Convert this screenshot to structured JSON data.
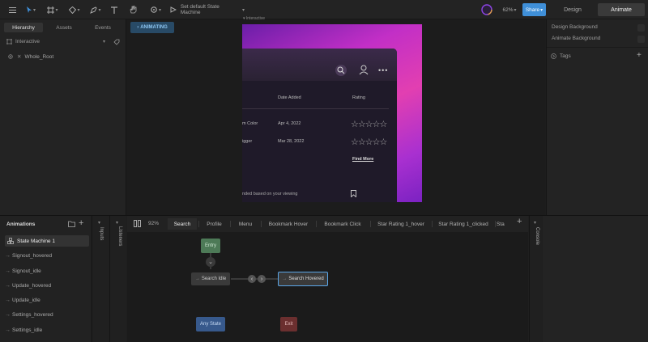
{
  "toolbar": {
    "state_machine_label": "Set default State Machine",
    "zoom": "62%",
    "share": "Share",
    "modes": [
      "Design",
      "Animate"
    ],
    "active_mode": "Animate"
  },
  "left": {
    "tabs": [
      "Hierarchy",
      "Assets",
      "Events"
    ],
    "active_tab": "Hierarchy",
    "artboard": "Interactive",
    "root": "Whole_Root"
  },
  "canvas": {
    "animating_badge": "ANIMATING",
    "artboard_label": "Interactive",
    "table": {
      "col_added": "Date Added",
      "col_rating": "Rating",
      "rows": [
        {
          "name": "m Color",
          "date": "Apr 4, 2022"
        },
        {
          "name": "igger",
          "date": "Mar 28, 2022"
        }
      ],
      "find_more": "Find More",
      "footer": "nded based on your viewing"
    }
  },
  "right": {
    "design_bg": "Design Background",
    "animate_bg": "Animate Background",
    "tags": "Tags"
  },
  "bottom": {
    "animations_title": "Animations",
    "animations": [
      "State Machine 1",
      "Signout_hovered",
      "Signout_idle",
      "Update_hovered",
      "Update_idle",
      "Settings_hovered",
      "Settings_idle"
    ],
    "side_labels": {
      "inputs": "Inputs",
      "listeners": "Listeners",
      "console": "Console"
    },
    "zoom": "92%",
    "state_tabs": [
      "Search",
      "Profile",
      "Menu",
      "Bookmark Hover",
      "Bookmark Click",
      "Star Rating 1_hover",
      "Star Rating 1_clicked",
      "Sta"
    ],
    "active_state_tab": "Search",
    "nodes": {
      "entry": "Entry",
      "search_idle": "Search Idle",
      "search_hovered": "Search Hovered",
      "any_state": "Any State",
      "exit": "Exit"
    }
  },
  "colors": {
    "accent": "#3f8fd8",
    "entry": "#4d7a57",
    "any_state": "#37598c",
    "exit": "#6b2f2f",
    "gradient_pink": "#e23fb1",
    "gradient_purple": "#6a1ea8"
  }
}
